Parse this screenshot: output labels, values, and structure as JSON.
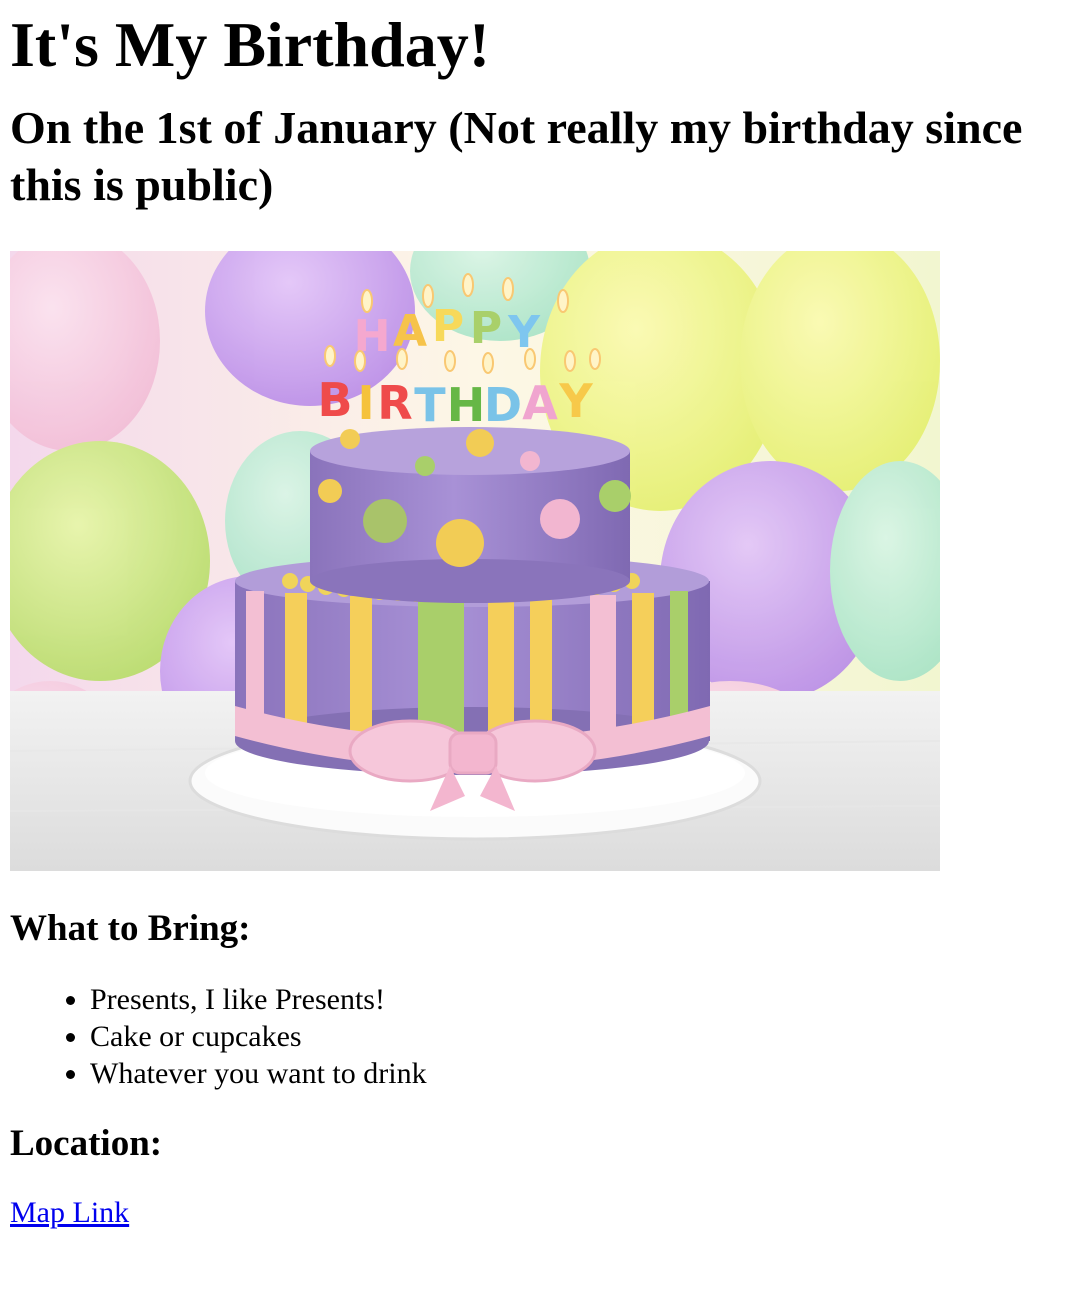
{
  "page": {
    "title": "It's My Birthday!",
    "subtitle": "On the 1st of January (Not really my birthday since this is public)"
  },
  "hero_image": {
    "candle_letters_top": "HAPPY",
    "candle_letters_bottom": "BIRTHDAY",
    "colors": {
      "cake_purple": "#9b85c9",
      "stripe_yellow": "#f5cf5a",
      "stripe_green": "#a9cf6a",
      "ribbon_pink": "#f3bfd3"
    }
  },
  "bring": {
    "heading": "What to Bring:",
    "items": [
      "Presents, I like Presents!",
      "Cake or cupcakes",
      "Whatever you want to drink"
    ]
  },
  "location": {
    "heading": "Location:",
    "link_text": "Map Link"
  }
}
